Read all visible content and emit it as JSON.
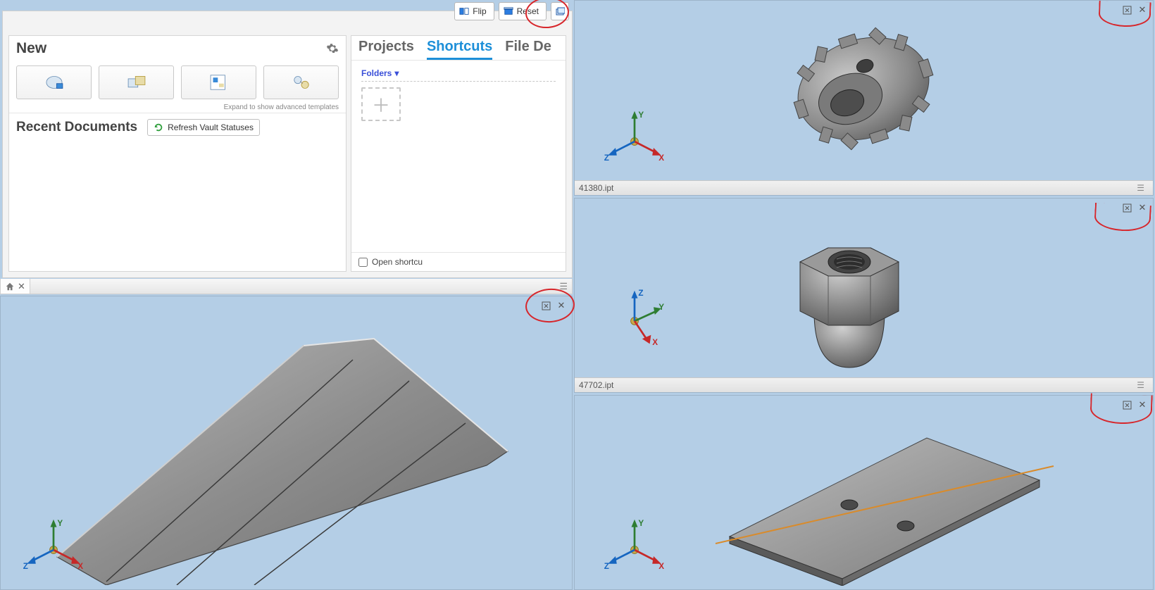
{
  "home": {
    "toolbar": {
      "flip_label": "Flip",
      "reset_label": "Reset"
    },
    "new_title": "New",
    "expand_hint": "Expand to show advanced templates",
    "recent_title": "Recent Documents",
    "refresh_label": "Refresh Vault Statuses",
    "templates": [
      {
        "name": "part-template"
      },
      {
        "name": "assembly-template"
      },
      {
        "name": "drawing-template"
      },
      {
        "name": "presentation-template"
      }
    ]
  },
  "side": {
    "tabs": {
      "projects": "Projects",
      "shortcuts": "Shortcuts",
      "file_details": "File De"
    },
    "folders_label": "Folders",
    "open_shortcut_label": "Open shortcu"
  },
  "home_footer": {
    "tab_close_tooltip": "Close"
  },
  "viewports": {
    "vp2": {
      "footer": "41380.ipt"
    },
    "vp3": {
      "footer": "47702.ipt"
    }
  },
  "axes": {
    "x": "X",
    "y": "Y",
    "z": "Z"
  }
}
